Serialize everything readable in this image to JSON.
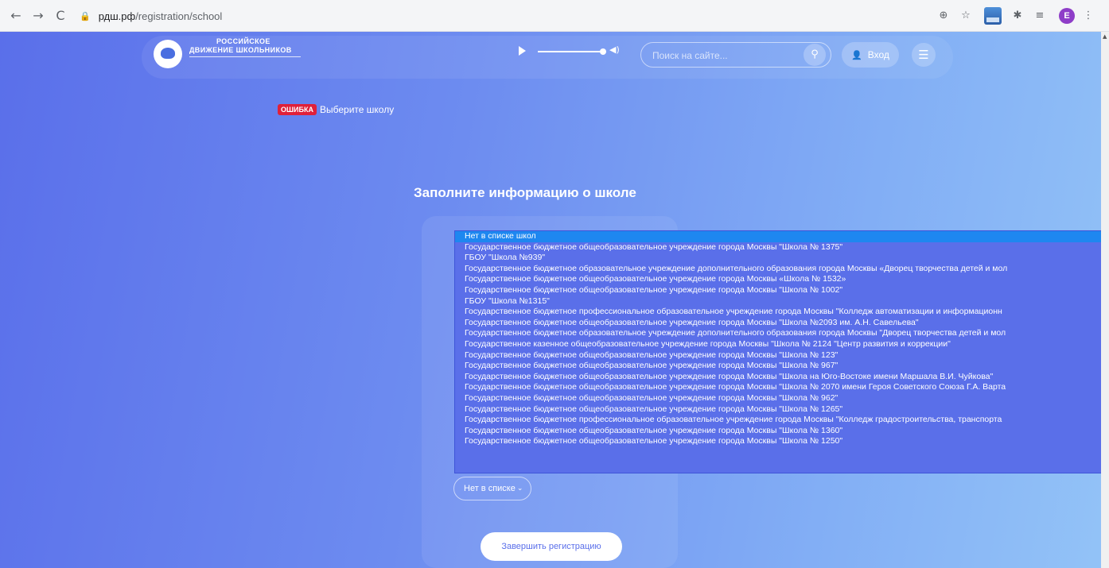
{
  "browser": {
    "back_icon": "←",
    "forward_icon": "→",
    "reload_icon": "C",
    "lock_icon": "🔒",
    "url_domain": "рдш.рф",
    "url_path": "/registration/school",
    "zoom_icon": "⊕",
    "star_icon": "☆",
    "extensions_icon": "✱",
    "reading_list_icon": "≡",
    "profile_letter": "E",
    "menu_icon": "⋮"
  },
  "header": {
    "logo_line1": "РОССИЙСКОЕ",
    "logo_line2": "ДВИЖЕНИЕ ШКОЛЬНИКОВ",
    "volume_icon": "◀)",
    "search_placeholder": "Поиск на сайте...",
    "search_icon": "⚲",
    "login_icon": "👤",
    "login_label": "Вход",
    "menu_icon": "☰"
  },
  "error": {
    "badge": "ОШИБКА",
    "message": "Выберите школу"
  },
  "form": {
    "title": "Заполните информацию о школе",
    "select_value": "Нет в списке",
    "select_chevron": "⌄",
    "submit_label": "Завершить регистрацию"
  },
  "dropdown": {
    "options": [
      "Нет в списке школ",
      "Государственное бюджетное общеобразовательное учреждение города Москвы \"Школа № 1375\"",
      "ГБОУ \"Школа №939\"",
      "Государственное бюджетное образовательное учреждение дополнительного образования города Москвы «Дворец творчества детей и мол",
      "Государственное бюджетное общеобразовательное учреждение города Москвы «Школа № 1532»",
      "Государственное бюджетное общеобразовательное учреждение города Москвы \"Школа № 1002\"",
      "ГБОУ \"Школа №1315\"",
      "Государственное бюджетное профессиональное образовательное учреждение города Москвы \"Колледж автоматизации и информационн",
      "Государственное бюджетное общеобразовательное учреждение города Москвы \"Школа №2093 им. А.Н. Савельева\"",
      "Государственное бюджетное образовательное учреждение дополнительного образования города Москвы \"Дворец творчества детей и мол",
      "Государственное казенное общеобразовательное учреждение города Москвы \"Школа № 2124 \"Центр развития и коррекции\"",
      "Государственное бюджетное общеобразовательное учреждение города Москвы \"Школа № 123\"",
      "Государственное бюджетное общеобразовательное учреждение города Москвы \"Школа № 967\"",
      "Государственное бюджетное общеобразовательное учреждение города Москвы \"Школа на Юго-Востоке имени Маршала В.И. Чуйкова\"",
      "Государственное бюджетное общеобразовательное учреждение города Москвы \"Школа № 2070 имени Героя Советского Союза Г.А. Варта",
      "Государственное бюджетное общеобразовательное учреждение города Москвы \"Школа № 962\"",
      "Государственное бюджетное общеобразовательное учреждение города Москвы \"Школа № 1265\"",
      "Государственное бюджетное профессиональное образовательное учреждение города Москвы \"Колледж градостроительства, транспорта",
      "Государственное бюджетное общеобразовательное учреждение города Москвы \"Школа № 1360\"",
      "Государственное бюджетное общеобразовательное учреждение города Москвы \"Школа № 1250\""
    ],
    "selected_index": 0
  }
}
